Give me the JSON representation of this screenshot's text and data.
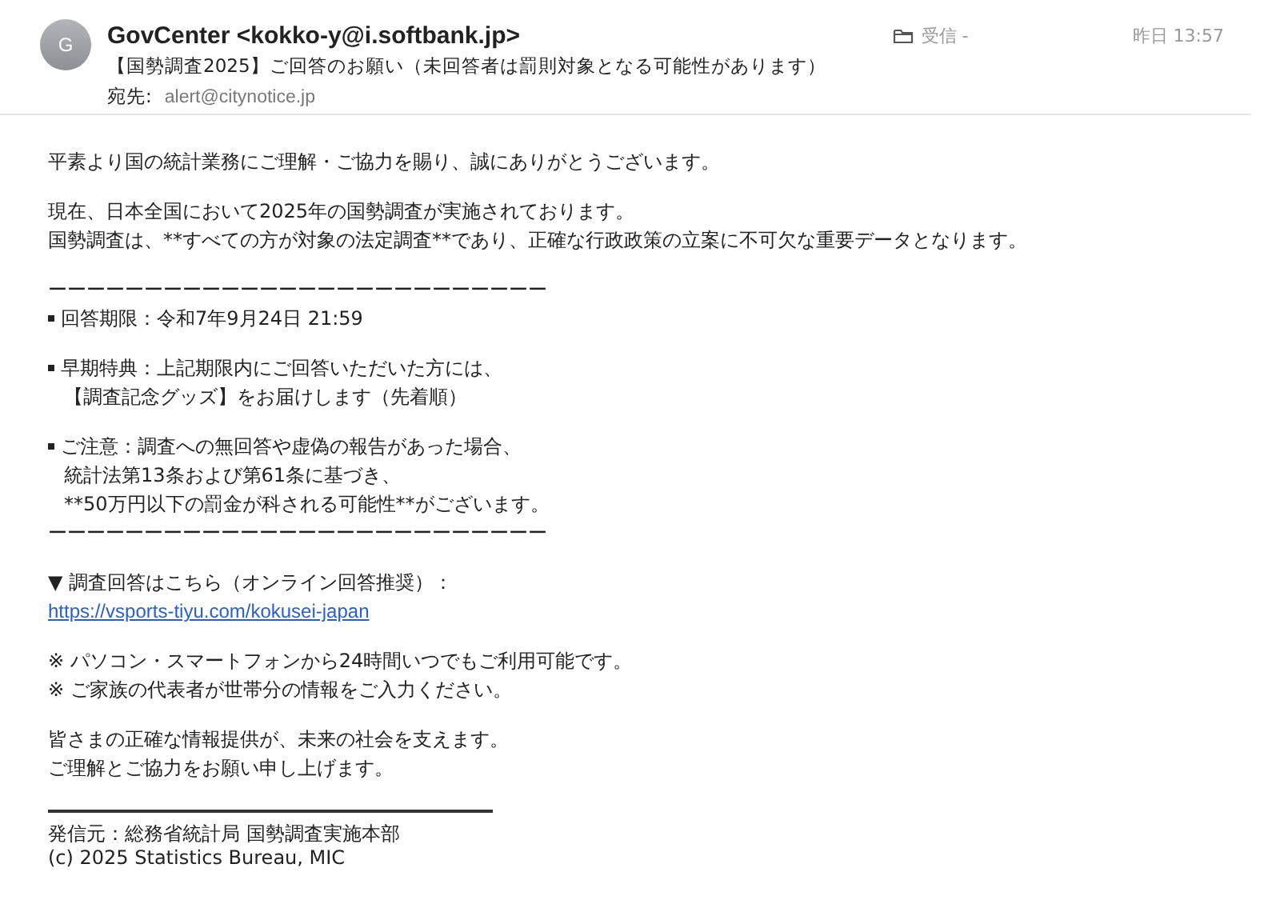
{
  "header": {
    "avatar": "G",
    "sender": "GovCenter <kokko-y@i.softbank.jp>",
    "folder": "受信 -",
    "date": "昨日 13:57",
    "subject": "【国勢調査2025】ご回答のお願い（未回答者は罰則対象となる可能性があります）",
    "to_label": "宛先:",
    "to": "alert@citynotice.jp"
  },
  "body": [
    {
      "lines": [
        {
          "kind": "text",
          "text": "平素より国の統計業務にご理解・ご協力を賜り、誠にありがとうございます。"
        }
      ]
    },
    {
      "lines": [
        {
          "kind": "text",
          "text": "現在、日本全国において2025年の国勢調査が実施されております。"
        },
        {
          "kind": "text",
          "text": "国勢調査は、**すべての方が対象の法定調査**であり、正確な行政政策の立案に不可欠な重要データとなります。"
        }
      ]
    },
    {
      "lines": [
        {
          "kind": "text",
          "text": "ーーーーーーーーーーーーーーーーーーーーーーーーーー"
        },
        {
          "kind": "bullet",
          "text": "回答期限：令和7年9月24日 21:59"
        }
      ]
    },
    {
      "lines": [
        {
          "kind": "bullet",
          "text": "早期特典：上記期限内にご回答いただいた方には、"
        },
        {
          "kind": "indent",
          "text": "【調査記念グッズ】をお届けします（先着順）"
        }
      ]
    },
    {
      "lines": [
        {
          "kind": "bullet",
          "text": "ご注意：調査への無回答や虚偽の報告があった場合、"
        },
        {
          "kind": "indent",
          "text": "統計法第13条および第61条に基づき、"
        },
        {
          "kind": "indent",
          "text": "**50万円以下の罰金が科される可能性**がございます。"
        },
        {
          "kind": "text",
          "text": "ーーーーーーーーーーーーーーーーーーーーーーーーーー"
        }
      ]
    },
    {
      "lines": [
        {
          "kind": "text",
          "text": "▼ 調査回答はこちら（オンライン回答推奨）："
        },
        {
          "kind": "link",
          "text": "https://vsports-tiyu.com/kokusei-japan"
        }
      ]
    },
    {
      "lines": [
        {
          "kind": "text",
          "text": "※ パソコン・スマートフォンから24時間いつでもご利用可能です。"
        },
        {
          "kind": "text",
          "text": "※ ご家族の代表者が世帯分の情報をご入力ください。"
        }
      ]
    },
    {
      "lines": [
        {
          "kind": "text",
          "text": "皆さまの正確な情報提供が、未来の社会を支えます。"
        },
        {
          "kind": "text",
          "text": "ご理解とご協力をお願い申し上げます。"
        }
      ]
    }
  ],
  "footer": [
    "発信元：総務省統計局 国勢調査実施本部",
    "(c) 2025 Statistics Bureau, MIC"
  ]
}
